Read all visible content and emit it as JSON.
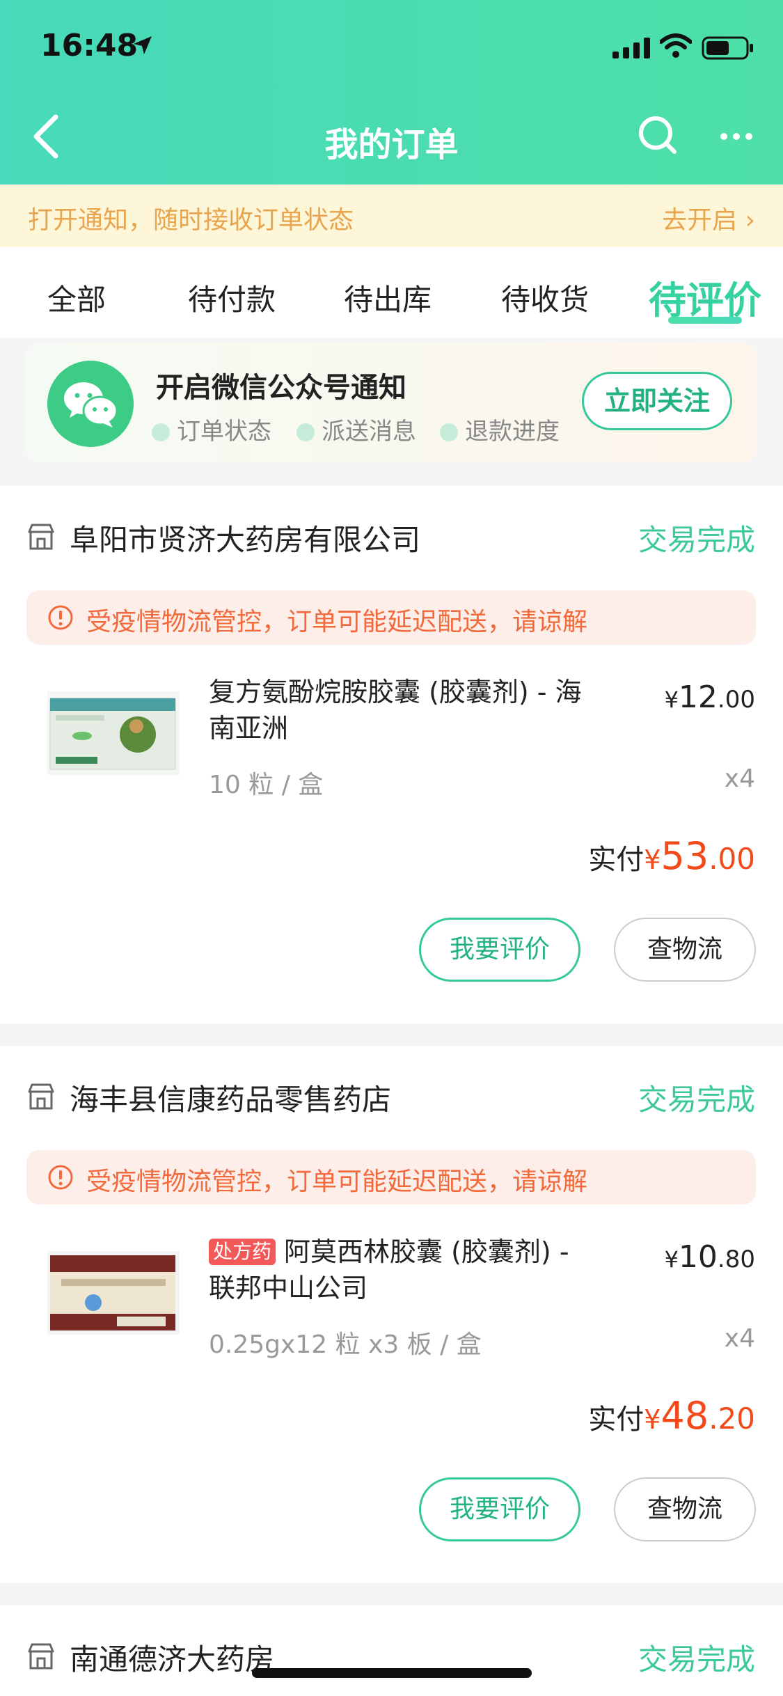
{
  "status_bar": {
    "time": "16:48"
  },
  "nav": {
    "title": "我的订单"
  },
  "notice": {
    "text": "打开通知，随时接收订单状态",
    "action": "去开启"
  },
  "tabs": [
    {
      "label": "全部"
    },
    {
      "label": "待付款"
    },
    {
      "label": "待出库"
    },
    {
      "label": "待收货"
    },
    {
      "label": "待评价",
      "active": true
    }
  ],
  "wechat": {
    "title": "开启微信公众号通知",
    "items": [
      "订单状态",
      "派送消息",
      "退款进度"
    ],
    "follow_label": "立即关注"
  },
  "orders": [
    {
      "store": "阜阳市贤济大药房有限公司",
      "status": "交易完成",
      "warning": "受疫情物流管控，订单可能延迟配送，请谅解",
      "product": {
        "name": "复方氨酚烷胺胶囊 (胶囊剂) - 海南亚洲",
        "price_currency": "¥",
        "price_int": "12",
        "price_dec": ".00",
        "spec": "10 粒 / 盒",
        "qty": "x4"
      },
      "paid_label": "实付",
      "paid_currency": "¥",
      "paid_int": "53",
      "paid_dec": ".00",
      "review_label": "我要评价",
      "logistics_label": "查物流"
    },
    {
      "store": "海丰县信康药品零售药店",
      "status": "交易完成",
      "warning": "受疫情物流管控，订单可能延迟配送，请谅解",
      "product": {
        "rx_badge": "处方药",
        "name": "阿莫西林胶囊 (胶囊剂) - 联邦中山公司",
        "price_currency": "¥",
        "price_int": "10",
        "price_dec": ".80",
        "spec": "0.25gx12 粒 x3 板 / 盒",
        "qty": "x4"
      },
      "paid_label": "实付",
      "paid_currency": "¥",
      "paid_int": "48",
      "paid_dec": ".20",
      "review_label": "我要评价",
      "logistics_label": "查物流"
    },
    {
      "store": "南通德济大药房",
      "status": "交易完成"
    }
  ],
  "colors": {
    "accent": "#35d1a0",
    "price": "#f24a1a",
    "warning": "#f26a3b"
  }
}
